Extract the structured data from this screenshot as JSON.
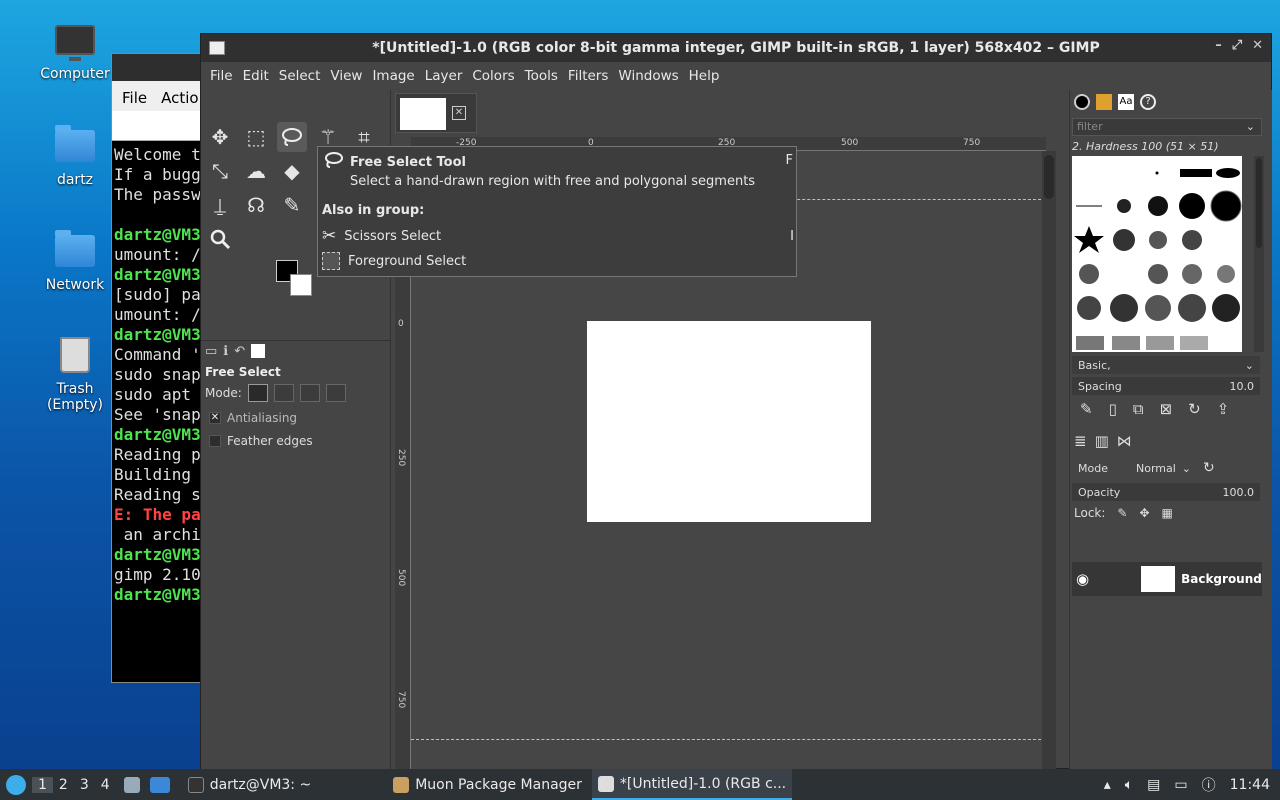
{
  "desktop": {
    "icons": [
      {
        "label": "Computer"
      },
      {
        "label": "dartz"
      },
      {
        "label": "Network"
      },
      {
        "label": "Trash (Empty)"
      }
    ]
  },
  "terminal": {
    "menu": [
      "File",
      "Actio"
    ],
    "lines": [
      {
        "text": "Welcome t",
        "cls": ""
      },
      {
        "text": "If a bugg",
        "cls": ""
      },
      {
        "text": "The passw",
        "cls": ""
      },
      {
        "text": "",
        "cls": ""
      },
      {
        "text": "dartz@VM3",
        "cls": "g"
      },
      {
        "text": "umount: /",
        "cls": ""
      },
      {
        "text": "dartz@VM3",
        "cls": "g"
      },
      {
        "text": "[sudo] pa",
        "cls": ""
      },
      {
        "text": "umount: /",
        "cls": ""
      },
      {
        "text": "dartz@VM3",
        "cls": "g"
      },
      {
        "text": "Command '",
        "cls": ""
      },
      {
        "text": "sudo snap",
        "cls": ""
      },
      {
        "text": "sudo apt ",
        "cls": ""
      },
      {
        "text": "See 'snap",
        "cls": ""
      },
      {
        "text": "dartz@VM3",
        "cls": "g"
      },
      {
        "text": "Reading p",
        "cls": ""
      },
      {
        "text": "Building ",
        "cls": ""
      },
      {
        "text": "Reading s",
        "cls": ""
      },
      {
        "text": "E: The pa",
        "cls": "r"
      },
      {
        "text": " an archi",
        "cls": ""
      },
      {
        "text": "dartz@VM3",
        "cls": "g"
      },
      {
        "text": "gimp 2.10",
        "cls": ""
      },
      {
        "text": "dartz@VM3",
        "cls": "g"
      }
    ]
  },
  "gimp": {
    "title": "*[Untitled]-1.0 (RGB color 8-bit gamma integer, GIMP built-in sRGB, 1 layer) 568x402 – GIMP",
    "menu": [
      "File",
      "Edit",
      "Select",
      "View",
      "Image",
      "Layer",
      "Colors",
      "Tools",
      "Filters",
      "Windows",
      "Help"
    ],
    "tool_options": {
      "title": "Free Select",
      "mode_label": "Mode:",
      "antialiasing": "Antialiasing",
      "feather": "Feather edges"
    },
    "rulers": {
      "h": [
        "-250",
        "0",
        "250",
        "500",
        "750"
      ],
      "v": [
        "0",
        "250",
        "500",
        "750"
      ]
    },
    "tooltip": {
      "title": "Free Select Tool",
      "shortcut": "F",
      "desc": "Select a hand-drawn region with free and polygonal segments",
      "group_label": "Also in group:",
      "items": [
        {
          "label": "Scissors Select",
          "shortcut": "I"
        },
        {
          "label": "Foreground Select",
          "shortcut": ""
        }
      ]
    },
    "brushes": {
      "filter_placeholder": "filter",
      "current": "2. Hardness 100 (51 × 51)",
      "preset": "Basic,",
      "spacing_label": "Spacing",
      "spacing_value": "10.0"
    },
    "layers": {
      "mode_label": "Mode",
      "mode_value": "Normal",
      "opacity_label": "Opacity",
      "opacity_value": "100.0",
      "lock_label": "Lock:",
      "layer_name": "Background"
    }
  },
  "taskbar": {
    "workspaces": [
      "1",
      "2",
      "3",
      "4"
    ],
    "tasks": [
      {
        "label": "dartz@VM3: ~"
      },
      {
        "label": "Muon Package Manager"
      },
      {
        "label": "*[Untitled]-1.0 (RGB c..."
      }
    ],
    "clock": "11:44"
  }
}
